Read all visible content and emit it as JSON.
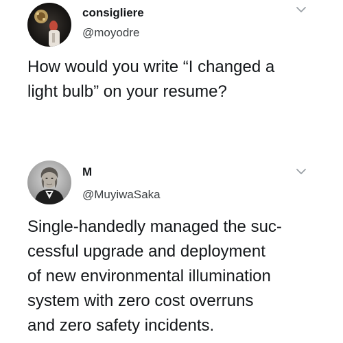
{
  "tweets": [
    {
      "display_name": "consigliere",
      "handle": "@moyodre",
      "avatar_icon": "profile-photo-consigliere",
      "menu_icon": "chevron-down-icon",
      "body_lines": [
        "How would you write “I changed a",
        "light bulb” on your resume?"
      ]
    },
    {
      "display_name": "M",
      "handle": "@MuyiwaSaka",
      "avatar_icon": "profile-photo-portrait",
      "menu_icon": "chevron-down-icon",
      "body_lines": [
        "Single-handedly managed the suc-",
        "cessful upgrade and deployment",
        "of new environmental illumination",
        "system with zero cost overruns",
        "and zero safety incidents."
      ]
    }
  ],
  "colors": {
    "text_primary": "#14171a",
    "text_secondary": "#3c4043",
    "chevron": "#9aa0a6",
    "background": "#ffffff"
  }
}
